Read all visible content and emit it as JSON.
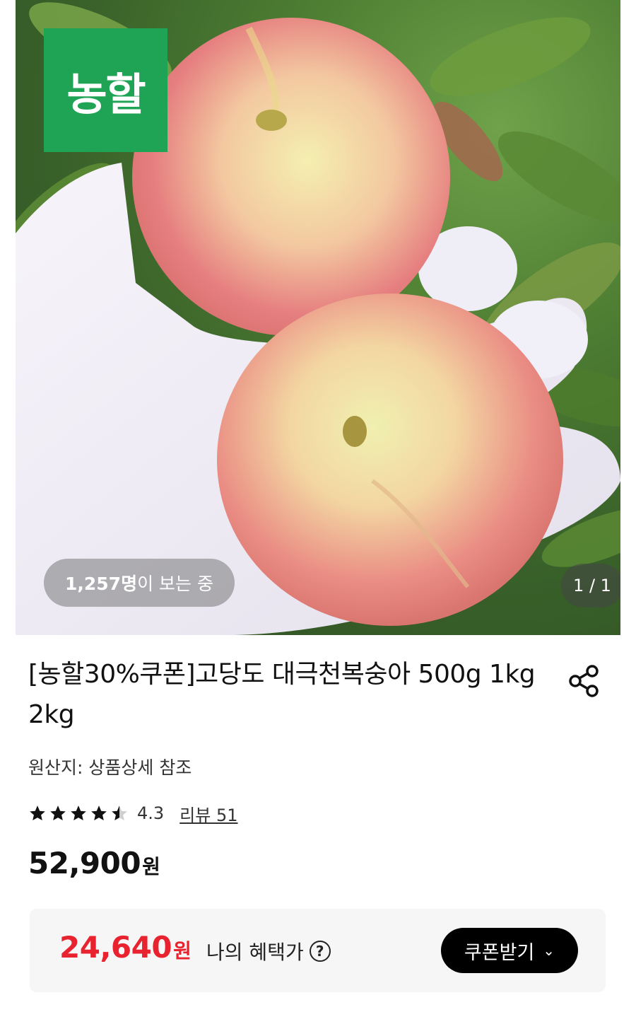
{
  "hero": {
    "brand_label": "농할",
    "viewers_count": "1,257명",
    "viewers_suffix": "이 보는 중",
    "page_indicator": "1 / 1"
  },
  "product": {
    "title": "[농할30%쿠폰]고당도 대극천복숭아 500g 1kg 2kg",
    "origin": "원산지: 상품상세 참조",
    "rating": "4.3",
    "rating_fraction": 0.86,
    "review_link": "리뷰 51",
    "price": "52,900",
    "price_unit": "원"
  },
  "benefit": {
    "price": "24,640",
    "price_unit": "원",
    "label": "나의 혜택가",
    "help_icon": "?",
    "coupon_button": "쿠폰받기",
    "coupon_chevron": "⌄"
  },
  "colors": {
    "brand_green": "#1ea454",
    "sale_red": "#e8232f",
    "button_black": "#000000"
  },
  "icons": {
    "share": "share-icon",
    "star": "star-icon",
    "help": "question-circle-icon",
    "chevron": "chevron-down-icon"
  }
}
